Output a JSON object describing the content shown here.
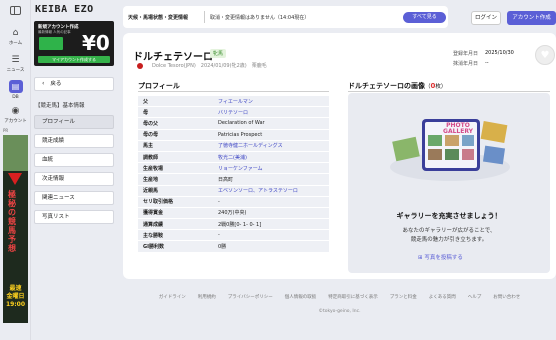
{
  "rail": {
    "items": [
      {
        "icon": "⌂",
        "label": "ホーム"
      },
      {
        "icon": "☰",
        "label": "ニュース"
      },
      {
        "icon": "▤",
        "label": "DB"
      },
      {
        "icon": "◉",
        "label": "アカウント"
      }
    ],
    "ad_sep": "PR",
    "ad_text": "極秘の競馬予想",
    "ad_sub": "最速\n金曜日\n19:00"
  },
  "sidebar": {
    "logo": "KEIBA EZO",
    "promo_title": "新規アカウント作成",
    "promo_sub": "最新情報 人気の記事",
    "promo_price": "¥0",
    "promo_button": "マイアカウント作成する",
    "back": "戻る",
    "section_title": "【競走馬】基本情報",
    "nav": [
      "プロフィール",
      "競走成績",
      "血統",
      "次走情報",
      "関連ニュース",
      "写真リスト"
    ]
  },
  "header": {
    "notice_label": "天候・馬場状態・変更情報",
    "notice_msg": "取消・変更情報はありません（14:04現在）",
    "notice_btn": "すべて見る",
    "login": "ログイン",
    "create": "アカウント作成"
  },
  "horse": {
    "name": "ドルチェテソーロ",
    "sex": "牝馬",
    "subline": "Dolce Tesoro(JPN)　2024/01/09(牝2歳)　栗鹿毛",
    "reg_label": "登録年月日",
    "reg_value": "2025/10/30",
    "del_label": "抹消年月日",
    "del_value": "--"
  },
  "profile": {
    "title": "プロフィール",
    "rows": [
      {
        "k": "父",
        "v": "フィエールマン",
        "link": true
      },
      {
        "k": "母",
        "v": "バリテソーロ",
        "link": true
      },
      {
        "k": "母の父",
        "v": "Declaration of War",
        "link": false
      },
      {
        "k": "母の母",
        "v": "Patricias Prospect",
        "link": false
      },
      {
        "k": "馬主",
        "v": "了徳寺健二ホールディングス",
        "link": true
      },
      {
        "k": "調教師",
        "v": "牧光二(美浦)",
        "link": true
      },
      {
        "k": "生産牧場",
        "v": "リョーケンファーム",
        "link": true
      },
      {
        "k": "生産地",
        "v": "日高町",
        "link": false
      },
      {
        "k": "近親馬",
        "v": "エベソンソーロ、アトラステソーロ",
        "link": true
      },
      {
        "k": "セリ取引価格",
        "v": "-",
        "link": false
      },
      {
        "k": "獲得賞金",
        "v": "240万(中央)",
        "link": false
      },
      {
        "k": "通算成績",
        "v": "2戦0勝[0- 1- 0- 1]",
        "link": false
      },
      {
        "k": "主な勝鞍",
        "v": "-",
        "link": false
      },
      {
        "k": "GI勝利数",
        "v": "0勝",
        "link": false
      }
    ]
  },
  "gallery": {
    "title": "ドルチェテソーロの画像",
    "count_open": "（",
    "count": "0",
    "count_close": "枚）",
    "art_title": "PHOTO\nGALLERY",
    "msg": "ギャラリーを充実させましょう！",
    "sub1": "あなたのギャラリーが広がることで、",
    "sub2": "競走馬の魅力が引き立ちます。",
    "post": "写真を投稿する"
  },
  "footer": {
    "links": [
      "ガイドライン",
      "利用規約",
      "プライバシーポリシー",
      "個人情報の取扱",
      "特定商取引に基づく表示",
      "プランと料金",
      "よくある質問",
      "ヘルプ",
      "お問い合わせ"
    ],
    "copy": "©tokyo-geino, Inc."
  }
}
